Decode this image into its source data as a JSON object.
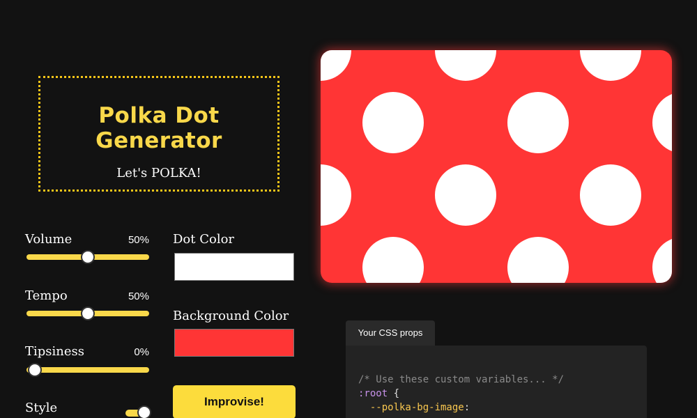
{
  "header": {
    "title": "Polka Dot Generator",
    "subtitle": "Let's POLKA!"
  },
  "controls": {
    "volume": {
      "label": "Volume",
      "value_text": "50%",
      "value": 0.5
    },
    "tempo": {
      "label": "Tempo",
      "value_text": "50%",
      "value": 0.5
    },
    "tipsiness": {
      "label": "Tipsiness",
      "value_text": "0%",
      "value": 0
    },
    "style": {
      "label": "Style",
      "toggle_on": true
    }
  },
  "colors": {
    "dot_label": "Dot Color",
    "dot_value": "#ffffff",
    "background_label": "Background Color",
    "background_value": "#ff3535"
  },
  "actions": {
    "improvise_label": "Improvise!"
  },
  "css_panel": {
    "tab_label": "Your CSS props",
    "comment": "/* Use these custom variables... */",
    "selector": ":root",
    "open_brace": " {",
    "property": "  --polka-bg-image",
    "colon": ":"
  }
}
